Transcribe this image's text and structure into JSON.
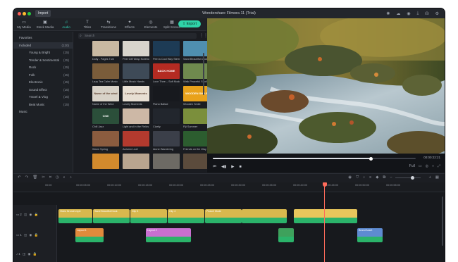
{
  "window": {
    "title": "Wondershare Filmora 11 (Trial)",
    "import_label": "Import",
    "export_label": "Export"
  },
  "toolbar": [
    {
      "label": "My Media",
      "icon": "folder-icon",
      "glyph": "▭"
    },
    {
      "label": "Stock Media",
      "icon": "stock-icon",
      "glyph": "▣"
    },
    {
      "label": "Audio",
      "icon": "music-icon",
      "glyph": "♫"
    },
    {
      "label": "Titles",
      "icon": "titles-icon",
      "glyph": "T"
    },
    {
      "label": "Transitions",
      "icon": "transitions-icon",
      "glyph": "⇆"
    },
    {
      "label": "Effects",
      "icon": "effects-icon",
      "glyph": "✦"
    },
    {
      "label": "Elements",
      "icon": "elements-icon",
      "glyph": "◎"
    },
    {
      "label": "Split Screen",
      "icon": "split-screen-icon",
      "glyph": "▦"
    }
  ],
  "active_tab": 3,
  "nav": [
    {
      "label": "Favorites",
      "count": "",
      "indent": 0
    },
    {
      "label": "Included",
      "count": "(120)",
      "indent": 0
    },
    {
      "label": "Young & Bright",
      "count": "(15)",
      "indent": 1
    },
    {
      "label": "Tender & Sentimental",
      "count": "(15)",
      "indent": 1
    },
    {
      "label": "Rock",
      "count": "(15)",
      "indent": 1
    },
    {
      "label": "Folk",
      "count": "(15)",
      "indent": 1
    },
    {
      "label": "Electronic",
      "count": "(15)",
      "indent": 1
    },
    {
      "label": "Sound Effect",
      "count": "(15)",
      "indent": 1
    },
    {
      "label": "Travel & Vlog",
      "count": "(15)",
      "indent": 1
    },
    {
      "label": "Beat Music",
      "count": "(15)",
      "indent": 1
    },
    {
      "label": "Music",
      "count": "",
      "indent": 0
    }
  ],
  "search": {
    "placeholder": "Search"
  },
  "media_grid": [
    {
      "caption": "Dolly - Pages Turn",
      "text": "",
      "bg": "#c9b9a2"
    },
    {
      "caption": "Peel Gift Wrap Notebook",
      "text": "",
      "bg": "#d8d4cc"
    },
    {
      "caption": "Peel a Cool Way Stem",
      "text": "",
      "bg": "#1d3b55"
    },
    {
      "caption": "Sand Beautiful Dock",
      "text": "",
      "bg": "#4f8fb0"
    },
    {
      "caption": "Lazy Tea Calm Music",
      "text": "",
      "bg": "#7a5c3a"
    },
    {
      "caption": "Little Music Hands",
      "text": "",
      "bg": "#3e4a57"
    },
    {
      "caption": "Love Thee – Soft Mode",
      "text": "BACK HOME",
      "bg": "#b42b22"
    },
    {
      "caption": "Walk Peaceful Stroll",
      "text": "",
      "bg": "#6f8a4e"
    },
    {
      "caption": "Name of the Wind",
      "text": "Name of the wind",
      "bg": "#d8d2c8"
    },
    {
      "caption": "Lovely Moments",
      "text": "Lovely Moments",
      "bg": "#e8dfd3"
    },
    {
      "caption": "Piano Ballad",
      "text": "",
      "bg": "#17191e"
    },
    {
      "caption": "Wooden Smile",
      "text": "WOODEN SMILE",
      "bg": "#e9a21b"
    },
    {
      "caption": "Chill Jazz",
      "text": "Chill",
      "bg": "#2b4f3a"
    },
    {
      "caption": "Light and in the Fields",
      "text": "",
      "bg": "#cdb8a6"
    },
    {
      "caption": "Clarity",
      "text": "",
      "bg": "#22262d"
    },
    {
      "caption": "Fiji Summer",
      "text": "",
      "bg": "#7b8f3c"
    },
    {
      "caption": "Warm Spring",
      "text": "",
      "bg": "#8b5c3f"
    },
    {
      "caption": "Autumn Leaf",
      "text": "",
      "bg": "#b33a2e"
    },
    {
      "caption": "Alone Wandering",
      "text": "",
      "bg": "#3b3f49"
    },
    {
      "caption": "Friends on the Way",
      "text": "",
      "bg": "#2c5d2f"
    },
    {
      "caption": "",
      "text": "",
      "bg": "#d28a2d"
    },
    {
      "caption": "",
      "text": "",
      "bg": "#b9a58f"
    },
    {
      "caption": "",
      "text": "",
      "bg": "#6d6a64"
    },
    {
      "caption": "",
      "text": "",
      "bg": "#5b4b3c"
    }
  ],
  "preview": {
    "timecode": "00:00:22:21",
    "progress": 0.78,
    "quality_label": "Full"
  },
  "timeline": {
    "ruler_labels": [
      "00:00",
      "00:00:05:00",
      "00:00:10:00",
      "00:00:15:00",
      "00:00:20:00",
      "00:00:25:00",
      "00:00:30:00",
      "00:00:35:00",
      "00:00:40:00",
      "00:00:45:00",
      "00:00:50:00",
      "00:00:55:00"
    ],
    "playhead_label": "00:00:22:21"
  },
  "clips": {
    "video_top": [
      {
        "label": "Video Brunch.mp4",
        "color": "#f0c85a"
      },
      {
        "label": "Sand Beautiful Dock",
        "color": "#f0c85a"
      },
      {
        "label": "Clip 3",
        "color": "#f0c85a"
      },
      {
        "label": "Clip 4",
        "color": "#f0c85a"
      },
      {
        "label": "Peacel Mode",
        "color": "#f0c85a"
      }
    ],
    "video_mid": [
      {
        "label": "Layout 1",
        "color": "#e08a3c"
      },
      {
        "label": "Layout 2",
        "color": "#c86fd0"
      },
      {
        "label": "",
        "color": "#3ea15c"
      },
      {
        "label": "Brand Asset",
        "color": "#5e8bd1"
      }
    ]
  }
}
